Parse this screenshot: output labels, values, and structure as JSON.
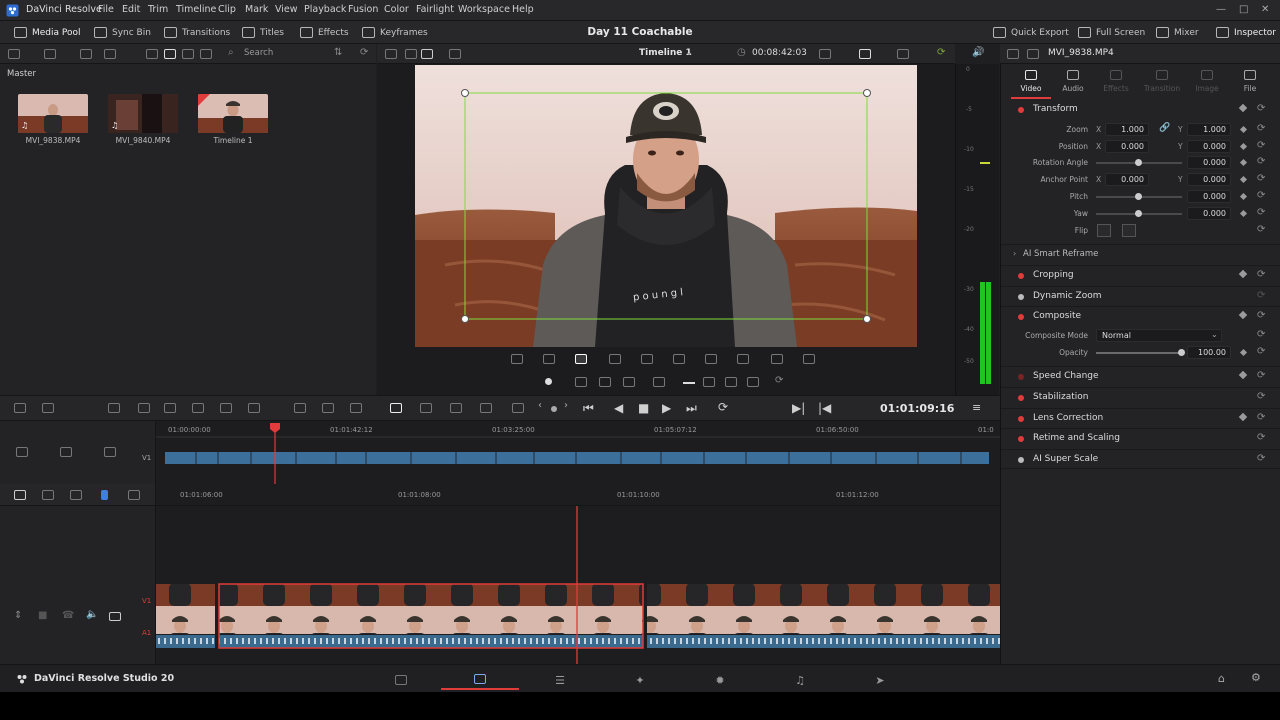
{
  "app": {
    "name": "DaVinci Resolve",
    "project_title": "Day 11 Coachable"
  },
  "menu": [
    "File",
    "Edit",
    "Trim",
    "Timeline",
    "Clip",
    "Mark",
    "View",
    "Playback",
    "Fusion",
    "Color",
    "Fairlight",
    "Workspace",
    "Help"
  ],
  "toolbar": {
    "left": [
      "Media Pool",
      "Sync Bin",
      "Transitions",
      "Titles",
      "Effects",
      "Keyframes"
    ],
    "right": [
      "Quick Export",
      "Full Screen",
      "Mixer",
      "Inspector"
    ]
  },
  "media_pool": {
    "search_placeholder": "Search",
    "bin": "Master",
    "clips": [
      {
        "name": "MVI_9838.MP4",
        "type_icon": "audio-video-icon"
      },
      {
        "name": "MVI_9840.MP4",
        "type_icon": "audio-video-icon"
      },
      {
        "name": "Timeline 1",
        "type_icon": "timeline-icon"
      }
    ]
  },
  "viewer": {
    "timeline_name": "Timeline 1",
    "duration": "00:08:42:03"
  },
  "audio_meter_labels": [
    "0",
    "-5",
    "-10",
    "-15",
    "-20",
    "-30",
    "-40",
    "-50"
  ],
  "inspector": {
    "clip_name": "MVI_9838.MP4",
    "tabs": [
      "Video",
      "Audio",
      "Effects",
      "Transition",
      "Image",
      "File"
    ],
    "transform": {
      "title": "Transform",
      "zoom_label": "Zoom",
      "zoom_x": "1.000",
      "zoom_y": "1.000",
      "position_label": "Position",
      "position_x": "0.000",
      "position_y": "0.000",
      "rotation_label": "Rotation Angle",
      "rotation": "0.000",
      "anchor_label": "Anchor Point",
      "anchor_x": "0.000",
      "anchor_y": "0.000",
      "pitch_label": "Pitch",
      "pitch": "0.000",
      "yaw_label": "Yaw",
      "yaw": "0.000",
      "flip_label": "Flip",
      "x_axis": "X",
      "y_axis": "Y"
    },
    "ai_smart_reframe": "AI Smart Reframe",
    "cropping": "Cropping",
    "dynamic_zoom": "Dynamic Zoom",
    "composite": {
      "title": "Composite",
      "mode_label": "Composite Mode",
      "mode": "Normal",
      "opacity_label": "Opacity",
      "opacity": "100.00"
    },
    "speed_change": "Speed Change",
    "stabilization": "Stabilization",
    "lens_correction": "Lens Correction",
    "retime_scaling": "Retime and Scaling",
    "ai_super_scale": "AI Super Scale"
  },
  "timeline": {
    "current_timecode": "01:01:09:16",
    "upper_ruler": [
      "01:00:00:00",
      "01:01:42:12",
      "01:03:25:00",
      "01:05:07:12",
      "01:06:50:00",
      "01:0"
    ],
    "lower_ruler": [
      "01:01:06:00",
      "01:01:08:00",
      "01:01:10:00",
      "01:01:12:00"
    ],
    "track_v1": "V1",
    "track_a1": "A1",
    "upper_track": "V1"
  },
  "pagebar": {
    "brand": "DaVinci Resolve Studio 20"
  },
  "colors": {
    "accent_red": "#e23b3b",
    "clip_audio_blue": "#3b6a8f",
    "meter_green": "#22c422",
    "bbox_green": "#7fdc3a"
  }
}
